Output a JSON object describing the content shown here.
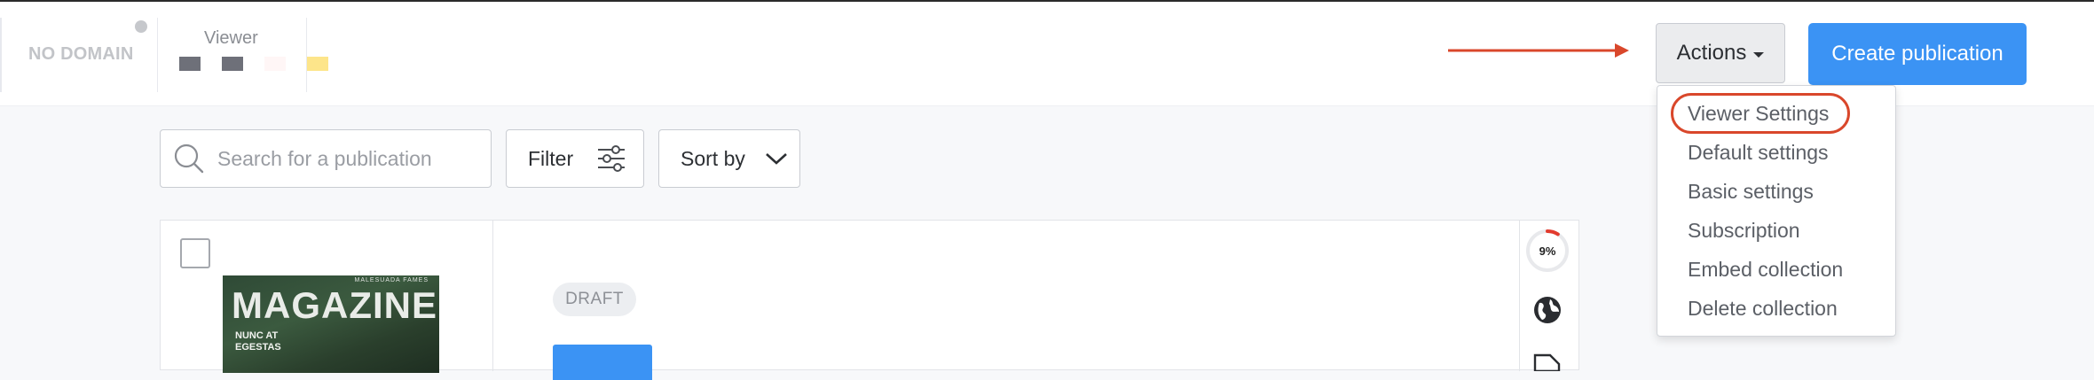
{
  "header": {
    "domain_label": "NO DOMAIN",
    "viewer_label": "Viewer",
    "viewer_swatches": [
      "#6e7079",
      "#6e7079",
      "#fff6f6",
      "#fde58a"
    ],
    "actions_label": "Actions",
    "create_label": "Create publication"
  },
  "toolbar": {
    "search_placeholder": "Search for a publication",
    "filter_label": "Filter",
    "sort_label": "Sort by"
  },
  "card": {
    "cover": {
      "title": "MAGAZINE",
      "subtitle": "NUNC AT EGESTAS",
      "small_text": "MALESUADA FAMES"
    },
    "status_badge": "DRAFT",
    "progress_text": "9%",
    "progress_value": 0.09
  },
  "actions_menu": {
    "items": [
      "Viewer Settings",
      "Default settings",
      "Basic settings",
      "Subscription",
      "Embed collection",
      "Delete collection"
    ],
    "highlighted_index": 0
  },
  "colors": {
    "primary": "#3b93f4",
    "annotation": "#d9472b",
    "progress": "#e23b2e"
  }
}
